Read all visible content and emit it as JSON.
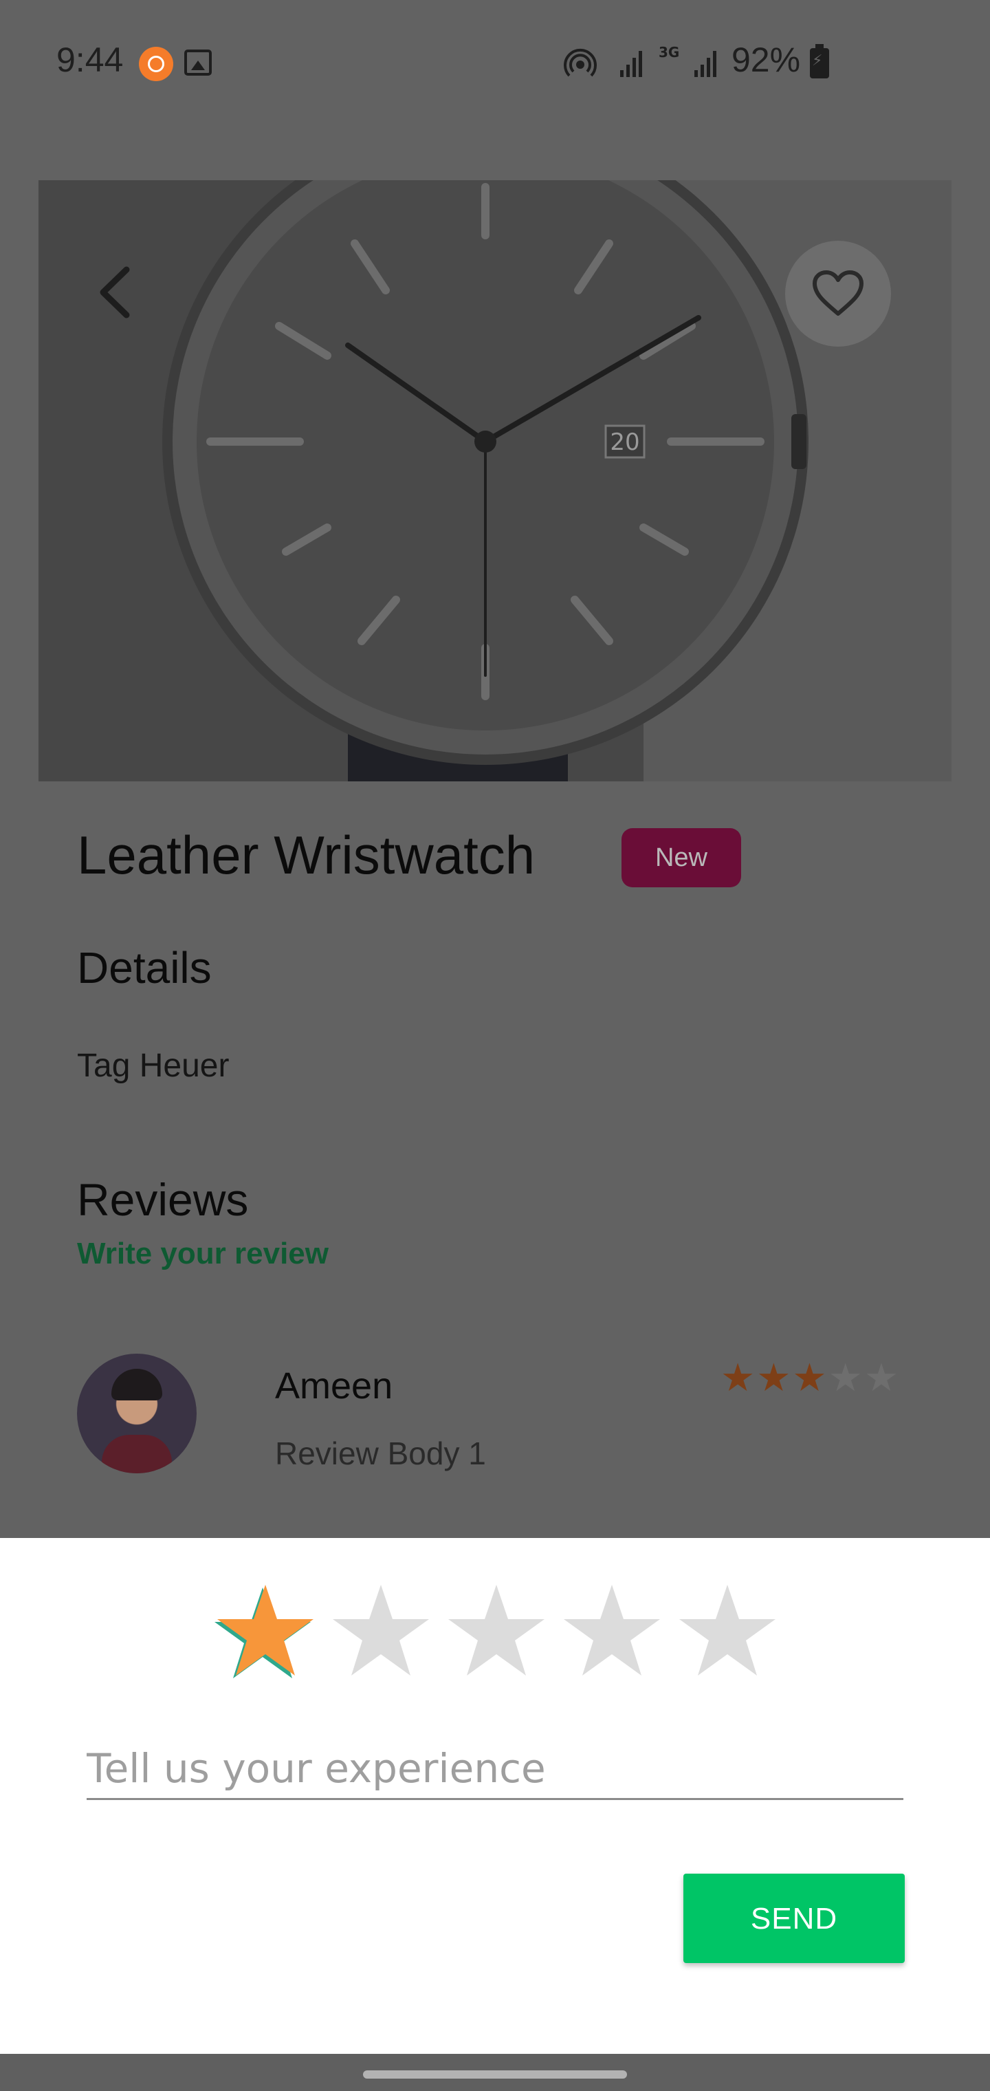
{
  "status_bar": {
    "time": "9:44",
    "network": "3G",
    "battery": "92%",
    "icons": [
      "mi-notification-icon",
      "gallery-icon",
      "hotspot-icon",
      "signal-icon",
      "battery-charging-icon"
    ]
  },
  "product": {
    "title": "Leather Wristwatch",
    "badge": "New",
    "details_heading": "Details",
    "details_body": "Tag Heuer",
    "image_icons": [
      "back-arrow-icon",
      "heart-icon"
    ]
  },
  "reviews": {
    "heading": "Reviews",
    "write_link": "Write your review",
    "items": [
      {
        "name": "Ameen",
        "body": "Review Body 1",
        "rating": 3,
        "max_rating": 5
      }
    ]
  },
  "review_sheet": {
    "rating": 1,
    "max_rating": 5,
    "placeholder": "Tell us your experience",
    "value": "",
    "send_label": "SEND"
  },
  "colors": {
    "accent_green": "#00c566",
    "link_green": "#0e5a32",
    "badge_bg": "#6a0d37",
    "star_active": "#f7963a",
    "star_inactive": "#dcdcdc",
    "overlay": "#626262"
  }
}
